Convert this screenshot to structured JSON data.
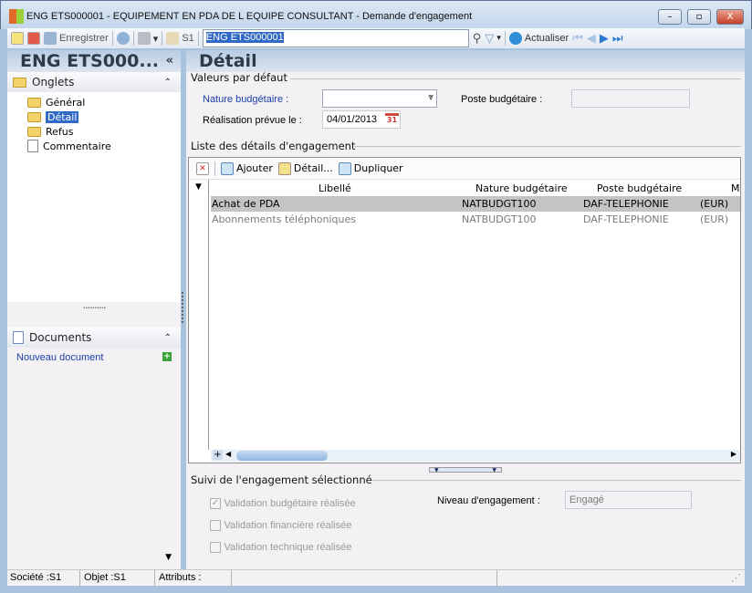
{
  "window": {
    "title": "ENG ETS000001 - EQUIPEMENT EN PDA DE L EQUIPE CONSULTANT -  Demande d'engagement",
    "minimize": "–",
    "maximize": "▫",
    "close": "X"
  },
  "toolbar": {
    "save_label": "Enregistrer",
    "folder_label": "S1",
    "search_value": "ENG ETS000001",
    "refresh_label": "Actualiser"
  },
  "left_header": "ENG ETS000...",
  "left_collapse": "«",
  "tabs_panel": {
    "title": "Onglets",
    "chevron": "⌃",
    "items": [
      {
        "label": "Général"
      },
      {
        "label": "Détail"
      },
      {
        "label": "Refus"
      },
      {
        "label": "Commentaire"
      }
    ]
  },
  "documents_panel": {
    "title": "Documents",
    "chevron": "⌃",
    "new_document": "Nouveau document",
    "add": "+"
  },
  "main_header": "Détail",
  "defaults": {
    "group": "Valeurs par défaut",
    "nature_label": "Nature budgétaire :",
    "nature_value": "",
    "poste_label": "Poste budgétaire :",
    "poste_value": "",
    "date_label": "Réalisation prévue le :",
    "date_value": "04/01/2013",
    "calendar_day": "31"
  },
  "details": {
    "group": "Liste des détails d'engagement",
    "add": "Ajouter",
    "detail": "Détail...",
    "duplicate": "Dupliquer",
    "columns": [
      "Libellé",
      "Nature budgétaire",
      "Poste budgétaire",
      "M"
    ],
    "rows": [
      [
        "Achat de PDA",
        "NATBUDGT100",
        "DAF-TELEPHONIE",
        "(EUR)"
      ],
      [
        "Abonnements téléphoniques",
        "NATBUDGT100",
        "DAF-TELEPHONIE",
        "(EUR)"
      ]
    ]
  },
  "follow": {
    "group": "Suivi de l'engagement sélectionné",
    "check1": "Validation budgétaire réalisée",
    "check1_checked": true,
    "check2": "Validation financière réalisée",
    "check2_checked": false,
    "check3": "Validation technique réalisée",
    "check3_checked": false,
    "level_label": "Niveau d'engagement :",
    "level_value": "Engagé"
  },
  "status": {
    "societe": "Société :S1",
    "objet": "Objet :S1",
    "attributs": "Attributs :"
  }
}
